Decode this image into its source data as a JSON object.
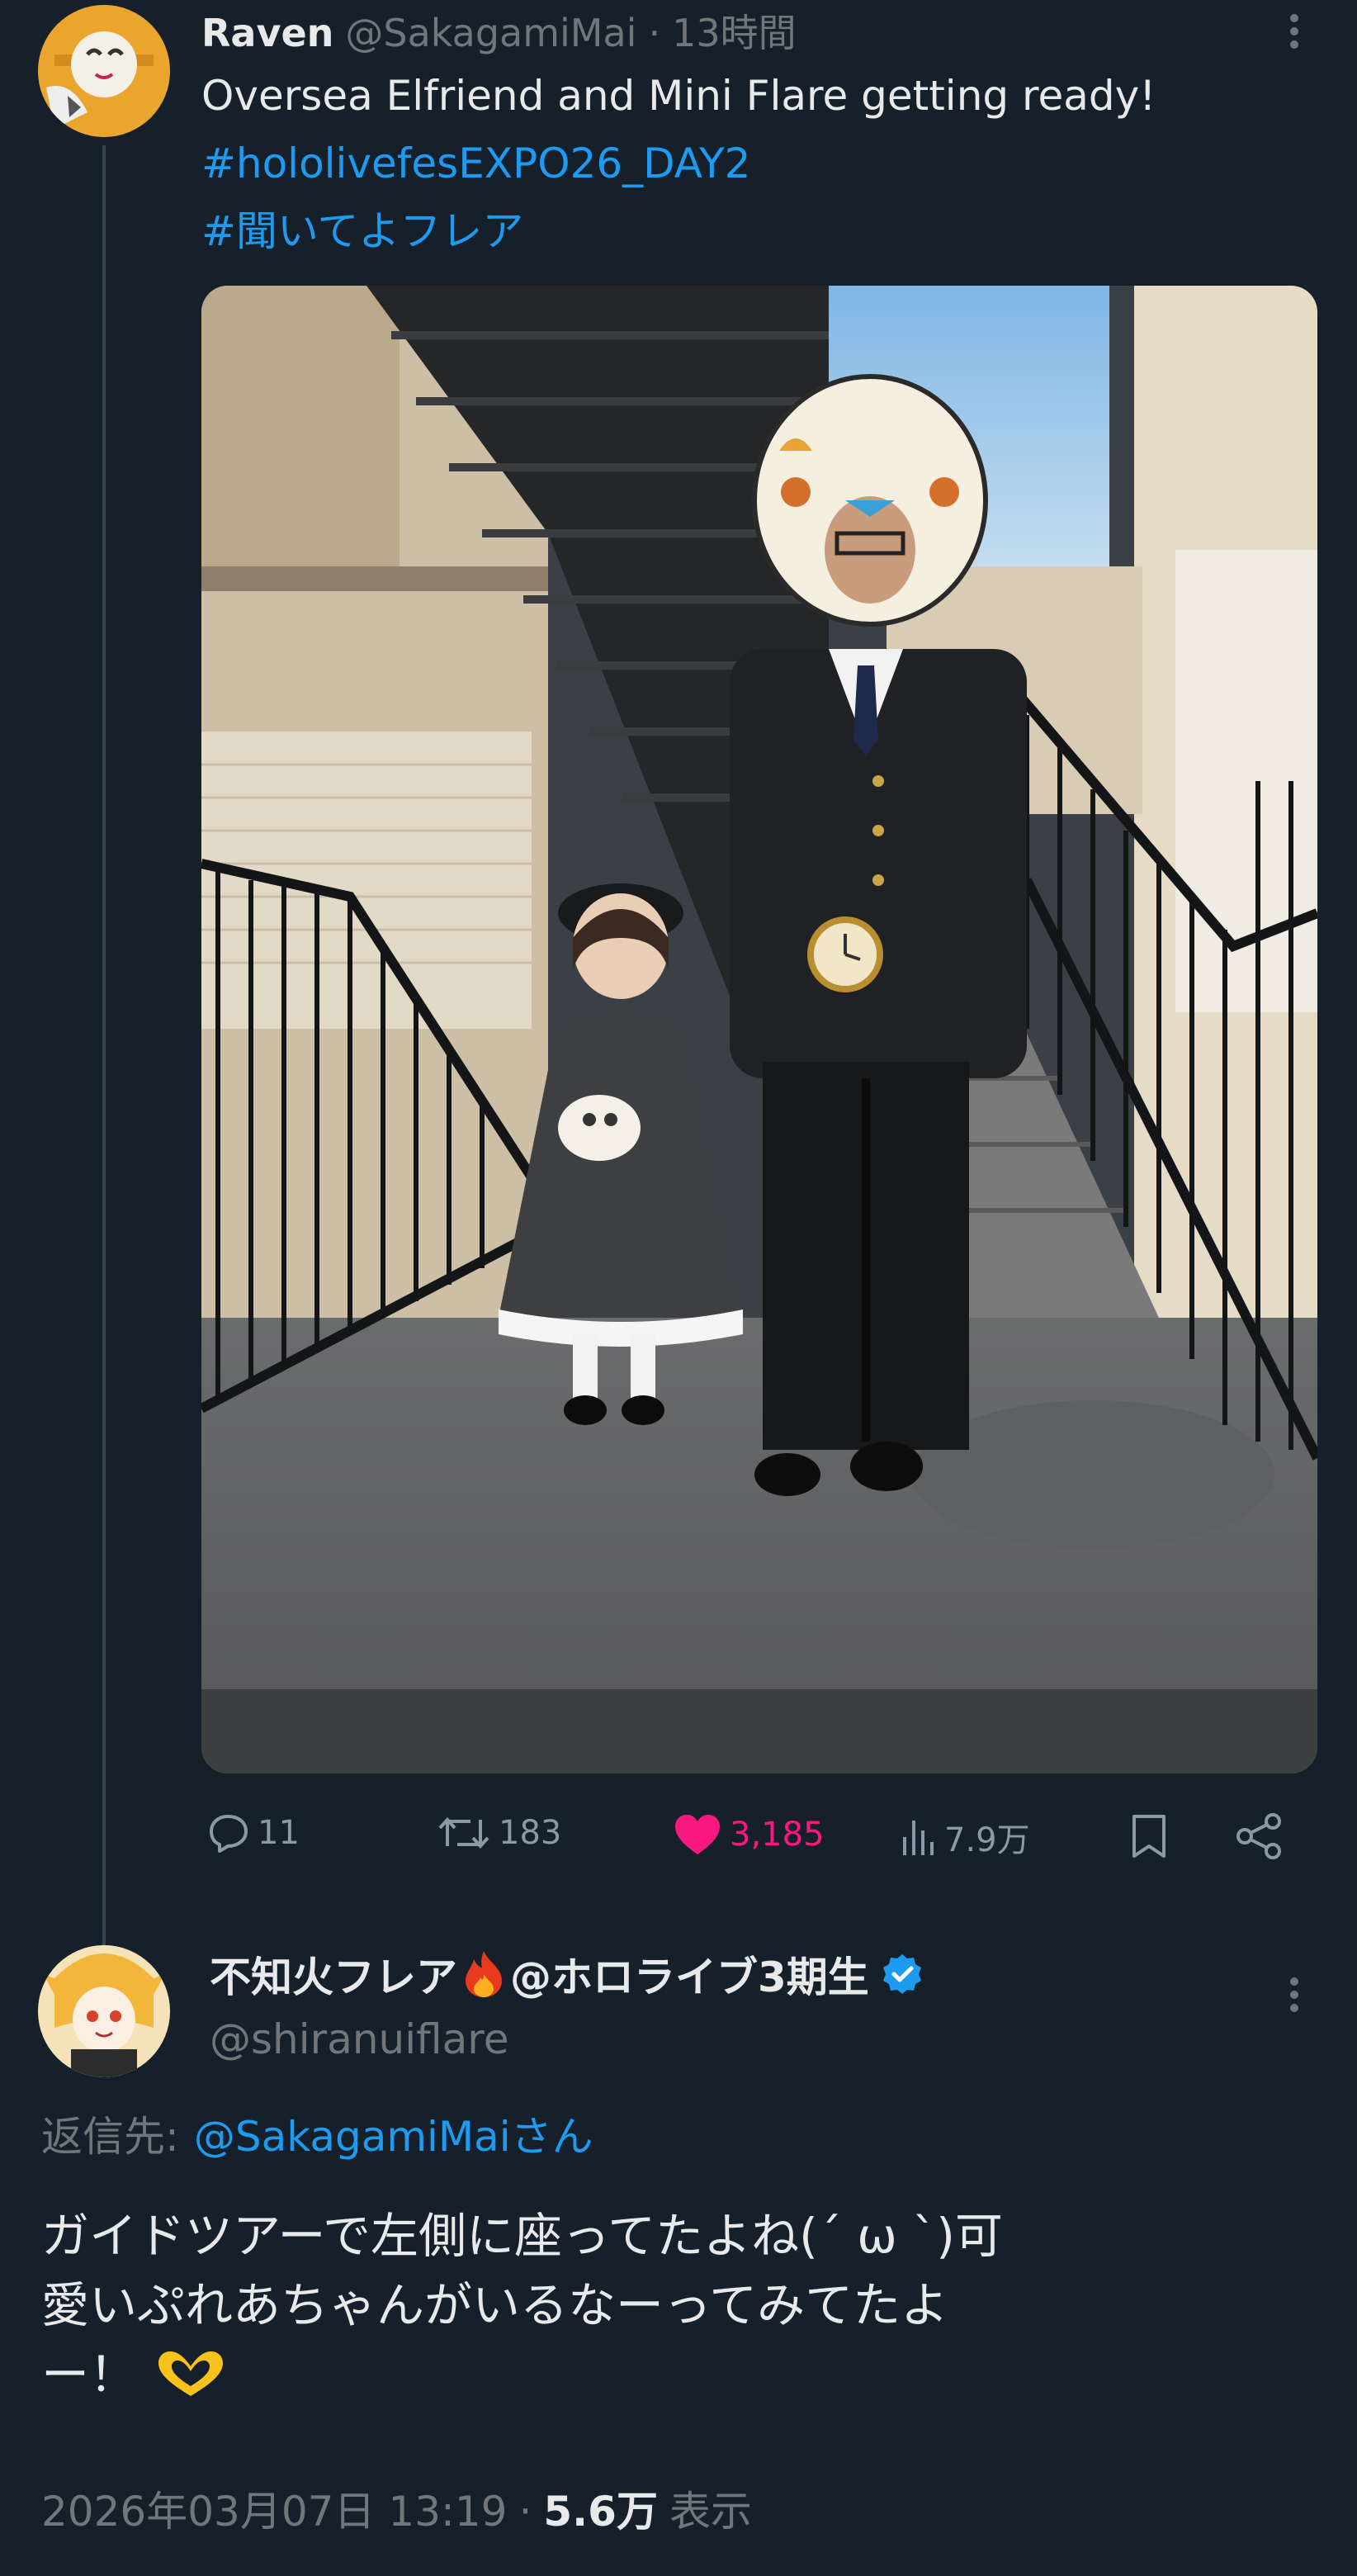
{
  "tweet": {
    "author_name": "Raven",
    "author_handle": "@SakagamiMai",
    "separator": "·",
    "time_ago": "13時間",
    "text": "Oversea Elfriend and Mini Flare getting ready!",
    "hashtags": [
      "#hololivefesEXPO26_DAY2",
      "#聞いてよフレア"
    ],
    "stats": {
      "replies": "11",
      "retweets": "183",
      "likes": "3,185",
      "views": "7.9万"
    }
  },
  "reply": {
    "author_name": "不知火フレア",
    "author_name_suffix": "@ホロライブ3期生",
    "author_handle": "@shiranuiflare",
    "replying_to_label": "返信先:",
    "replying_to_handle": "@SakagamiMaiさん",
    "text_line1": "ガイドツアーで左側に座ってたよね(ˊ ω ˋ)可",
    "text_line2": "愛いぷれあちゃんがいるなーってみてたよ",
    "text_line3": "ー！",
    "timestamp": "2026年03月07日 13:19",
    "separator": "·",
    "views": "5.6万",
    "views_label": "表示"
  },
  "colors": {
    "background": "#15202b",
    "accent": "#1d9bf0",
    "like": "#f91880",
    "muted": "#71767b"
  },
  "icons": [
    "more-icon",
    "reply-icon",
    "retweet-icon",
    "like-icon",
    "views-icon",
    "bookmark-icon",
    "share-icon",
    "fire-icon",
    "verified-icon",
    "heart-hands-icon"
  ]
}
